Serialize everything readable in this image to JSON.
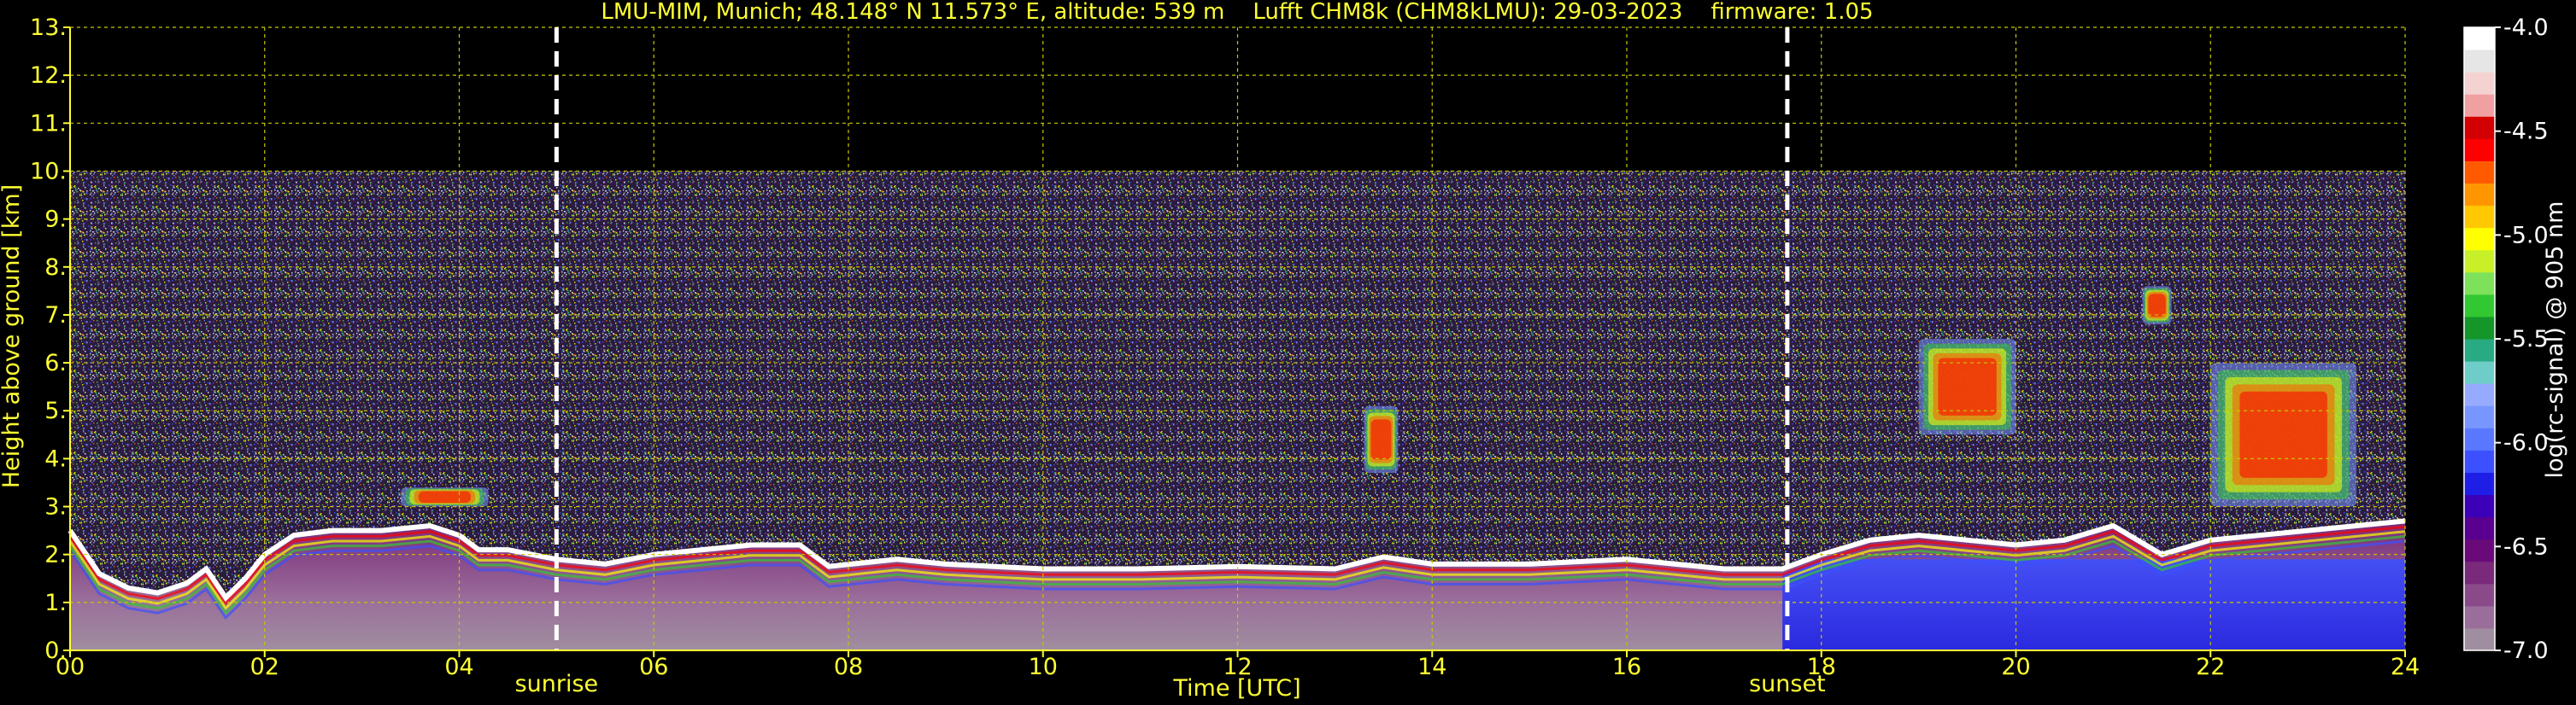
{
  "chart_data": {
    "type": "heatmap",
    "title": "LMU-MIM, Munich; 48.148° N 11.573° E, altitude: 539 m    Lufft CHM8k (CHM8kLMU): 29-03-2023    firmware: 1.05",
    "xlabel": "Time [UTC]",
    "ylabel": "Height above ground [km]",
    "xlim": [
      0,
      24
    ],
    "ylim": [
      0,
      13
    ],
    "x_ticks": [
      "00",
      "02",
      "04",
      "06",
      "08",
      "10",
      "12",
      "14",
      "16",
      "18",
      "20",
      "22",
      "24"
    ],
    "y_ticks": [
      "0.",
      "1.",
      "2.",
      "3.",
      "4.",
      "5.",
      "6.",
      "7.",
      "8.",
      "9.",
      "10.",
      "11.",
      "12.",
      "13."
    ],
    "grid": true,
    "data_top_km": 10,
    "events": [
      {
        "label": "sunrise",
        "time": 5.0
      },
      {
        "label": "sunset",
        "time": 17.65
      }
    ],
    "colorbar": {
      "label": "log(rc-signal) @ 905 nm",
      "range": [
        -7.0,
        -4.0
      ],
      "ticks": [
        "-4.0",
        "-4.5",
        "-5.0",
        "-5.5",
        "-6.0",
        "-6.5",
        "-7.0"
      ],
      "colors": [
        "#a08ea0",
        "#9a6e9a",
        "#8a4a8a",
        "#7a2a7a",
        "#6a0a7a",
        "#5a0090",
        "#3c00b8",
        "#1e1ee6",
        "#3c50ff",
        "#5a78ff",
        "#7896ff",
        "#96aaff",
        "#6ecdc8",
        "#28aa82",
        "#149628",
        "#32c832",
        "#7ee15a",
        "#c8f028",
        "#ffff00",
        "#ffc800",
        "#ff9600",
        "#ff5a00",
        "#ff0000",
        "#d20000",
        "#f0a0a0",
        "#f5d2d2",
        "#e6e6e6",
        "#ffffff"
      ]
    },
    "layer_top_km": [
      [
        0.0,
        2.5
      ],
      [
        0.3,
        1.6
      ],
      [
        0.6,
        1.3
      ],
      [
        0.9,
        1.2
      ],
      [
        1.2,
        1.4
      ],
      [
        1.4,
        1.7
      ],
      [
        1.6,
        1.1
      ],
      [
        1.8,
        1.5
      ],
      [
        2.0,
        2.0
      ],
      [
        2.3,
        2.4
      ],
      [
        2.7,
        2.5
      ],
      [
        3.2,
        2.5
      ],
      [
        3.7,
        2.6
      ],
      [
        4.0,
        2.4
      ],
      [
        4.2,
        2.1
      ],
      [
        4.5,
        2.1
      ],
      [
        5.0,
        1.9
      ],
      [
        5.5,
        1.8
      ],
      [
        6.0,
        2.0
      ],
      [
        6.5,
        2.1
      ],
      [
        7.0,
        2.2
      ],
      [
        7.5,
        2.2
      ],
      [
        7.8,
        1.75
      ],
      [
        8.5,
        1.9
      ],
      [
        9.0,
        1.8
      ],
      [
        9.5,
        1.75
      ],
      [
        10.0,
        1.7
      ],
      [
        11.0,
        1.7
      ],
      [
        12.0,
        1.75
      ],
      [
        13.0,
        1.7
      ],
      [
        13.5,
        1.95
      ],
      [
        14.0,
        1.8
      ],
      [
        15.0,
        1.8
      ],
      [
        16.0,
        1.9
      ],
      [
        16.5,
        1.8
      ],
      [
        17.0,
        1.7
      ],
      [
        17.6,
        1.7
      ],
      [
        18.0,
        2.0
      ],
      [
        18.5,
        2.3
      ],
      [
        19.0,
        2.4
      ],
      [
        19.5,
        2.3
      ],
      [
        20.0,
        2.2
      ],
      [
        20.5,
        2.3
      ],
      [
        21.0,
        2.6
      ],
      [
        21.5,
        2.0
      ],
      [
        22.0,
        2.3
      ],
      [
        22.5,
        2.4
      ],
      [
        23.0,
        2.5
      ],
      [
        23.5,
        2.6
      ],
      [
        24.0,
        2.7
      ]
    ],
    "cloud_patches": [
      {
        "time": [
          13.3,
          13.65
        ],
        "height_km": [
          3.7,
          5.1
        ]
      },
      {
        "time": [
          19.0,
          20.0
        ],
        "height_km": [
          4.5,
          6.5
        ]
      },
      {
        "time": [
          21.3,
          21.6
        ],
        "height_km": [
          6.8,
          7.6
        ]
      },
      {
        "time": [
          22.0,
          23.5
        ],
        "height_km": [
          3.0,
          6.0
        ]
      },
      {
        "time": [
          3.4,
          4.3
        ],
        "height_km": [
          3.0,
          3.4
        ]
      }
    ]
  }
}
